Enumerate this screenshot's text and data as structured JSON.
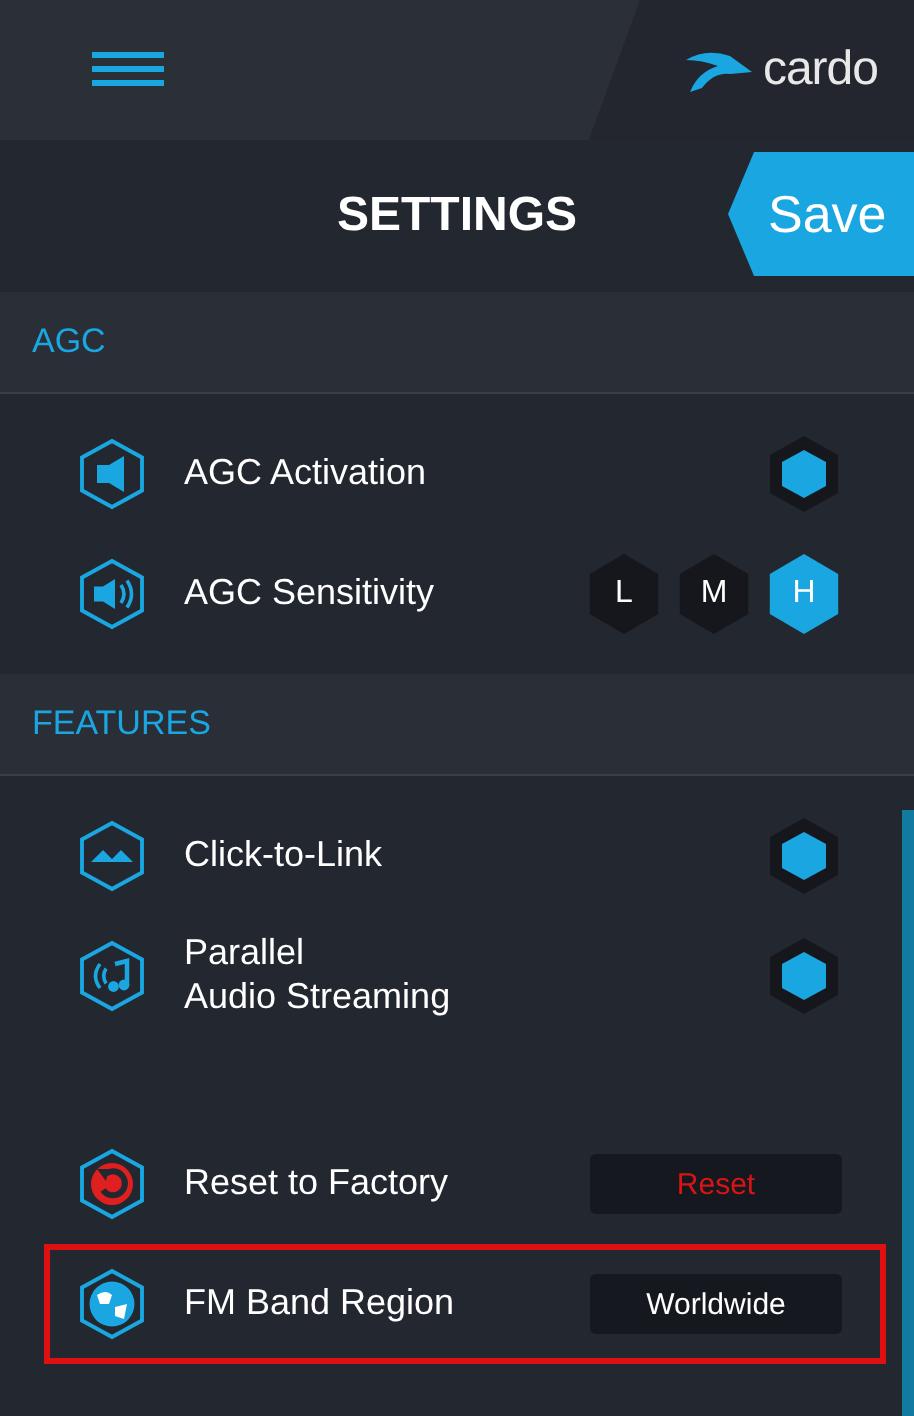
{
  "header": {
    "logo": "cardo"
  },
  "title": "SETTINGS",
  "save_button": "Save",
  "sections": [
    {
      "title": "AGC",
      "items": [
        {
          "kind": "toggle",
          "label": "AGC Activation",
          "on": true
        },
        {
          "kind": "levels",
          "label": "AGC Sensitivity",
          "options": [
            {
              "label": "L",
              "selected": false
            },
            {
              "label": "M",
              "selected": false
            },
            {
              "label": "H",
              "selected": true
            }
          ]
        }
      ]
    },
    {
      "title": "FEATURES",
      "items": [
        {
          "kind": "toggle",
          "label": "Click-to-Link",
          "on": true
        },
        {
          "kind": "toggle",
          "label": "Parallel\nAudio Streaming",
          "on": true
        }
      ]
    },
    {
      "items": [
        {
          "kind": "action",
          "label": "Reset to Factory",
          "button": "Reset",
          "danger": true,
          "highlighted": false
        },
        {
          "kind": "action",
          "label": "FM Band Region",
          "button": "Worldwide",
          "danger": false,
          "highlighted": true
        }
      ]
    }
  ]
}
